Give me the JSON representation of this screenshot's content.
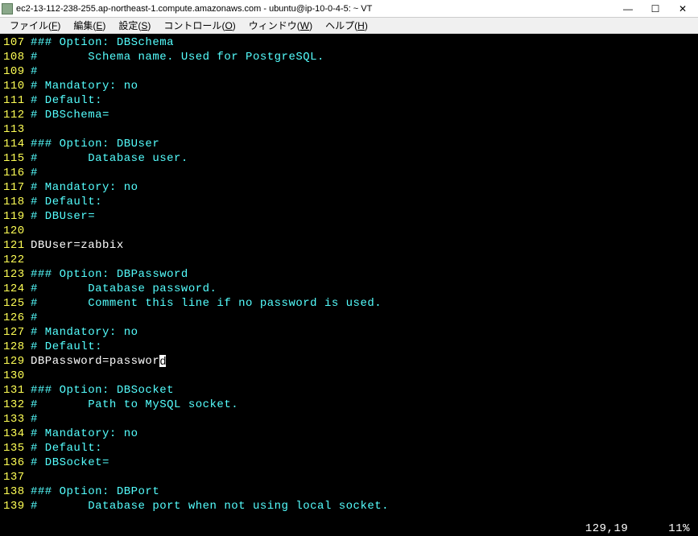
{
  "window": {
    "title": "ec2-13-112-238-255.ap-northeast-1.compute.amazonaws.com - ubuntu@ip-10-0-4-5: ~ VT",
    "minimize": "—",
    "maximize": "☐",
    "close": "✕"
  },
  "menu": {
    "file": {
      "label": "ファイル",
      "accel": "F"
    },
    "edit": {
      "label": "編集",
      "accel": "E"
    },
    "setup": {
      "label": "設定",
      "accel": "S"
    },
    "control": {
      "label": "コントロール",
      "accel": "O"
    },
    "window": {
      "label": "ウィンドウ",
      "accel": "W"
    },
    "help": {
      "label": "ヘルプ",
      "accel": "H"
    }
  },
  "lines": [
    {
      "n": "107",
      "segs": [
        {
          "c": "cyan",
          "t": "### Option: DBSchema"
        }
      ]
    },
    {
      "n": "108",
      "segs": [
        {
          "c": "cyan",
          "t": "#       Schema name. Used for PostgreSQL."
        }
      ]
    },
    {
      "n": "109",
      "segs": [
        {
          "c": "cyan",
          "t": "#"
        }
      ]
    },
    {
      "n": "110",
      "segs": [
        {
          "c": "cyan",
          "t": "# Mandatory: no"
        }
      ]
    },
    {
      "n": "111",
      "segs": [
        {
          "c": "cyan",
          "t": "# Default:"
        }
      ]
    },
    {
      "n": "112",
      "segs": [
        {
          "c": "cyan",
          "t": "# DBSchema="
        }
      ]
    },
    {
      "n": "113",
      "segs": []
    },
    {
      "n": "114",
      "segs": [
        {
          "c": "cyan",
          "t": "### Option: DBUser"
        }
      ]
    },
    {
      "n": "115",
      "segs": [
        {
          "c": "cyan",
          "t": "#       Database user."
        }
      ]
    },
    {
      "n": "116",
      "segs": [
        {
          "c": "cyan",
          "t": "#"
        }
      ]
    },
    {
      "n": "117",
      "segs": [
        {
          "c": "cyan",
          "t": "# Mandatory: no"
        }
      ]
    },
    {
      "n": "118",
      "segs": [
        {
          "c": "cyan",
          "t": "# Default:"
        }
      ]
    },
    {
      "n": "119",
      "segs": [
        {
          "c": "cyan",
          "t": "# DBUser="
        }
      ]
    },
    {
      "n": "120",
      "segs": []
    },
    {
      "n": "121",
      "segs": [
        {
          "c": "white",
          "t": "DBUser=zabbix"
        }
      ]
    },
    {
      "n": "122",
      "segs": []
    },
    {
      "n": "123",
      "segs": [
        {
          "c": "cyan",
          "t": "### Option: DBPassword"
        }
      ]
    },
    {
      "n": "124",
      "segs": [
        {
          "c": "cyan",
          "t": "#       Database password."
        }
      ]
    },
    {
      "n": "125",
      "segs": [
        {
          "c": "cyan",
          "t": "#       Comment this line if no password is used."
        }
      ]
    },
    {
      "n": "126",
      "segs": [
        {
          "c": "cyan",
          "t": "#"
        }
      ]
    },
    {
      "n": "127",
      "segs": [
        {
          "c": "cyan",
          "t": "# Mandatory: no"
        }
      ]
    },
    {
      "n": "128",
      "segs": [
        {
          "c": "cyan",
          "t": "# Default:"
        }
      ]
    },
    {
      "n": "129",
      "segs": [
        {
          "c": "white",
          "t": "DBPassword=passwor"
        },
        {
          "cursor": true,
          "t": "d"
        }
      ]
    },
    {
      "n": "130",
      "segs": []
    },
    {
      "n": "131",
      "segs": [
        {
          "c": "cyan",
          "t": "### Option: DBSocket"
        }
      ]
    },
    {
      "n": "132",
      "segs": [
        {
          "c": "cyan",
          "t": "#       Path to MySQL socket."
        }
      ]
    },
    {
      "n": "133",
      "segs": [
        {
          "c": "cyan",
          "t": "#"
        }
      ]
    },
    {
      "n": "134",
      "segs": [
        {
          "c": "cyan",
          "t": "# Mandatory: no"
        }
      ]
    },
    {
      "n": "135",
      "segs": [
        {
          "c": "cyan",
          "t": "# Default:"
        }
      ]
    },
    {
      "n": "136",
      "segs": [
        {
          "c": "cyan",
          "t": "# DBSocket="
        }
      ]
    },
    {
      "n": "137",
      "segs": []
    },
    {
      "n": "138",
      "segs": [
        {
          "c": "cyan",
          "t": "### Option: DBPort"
        }
      ]
    },
    {
      "n": "139",
      "segs": [
        {
          "c": "cyan",
          "t": "#       Database port when not using local socket."
        }
      ]
    }
  ],
  "status": {
    "position": "129,19",
    "percent": "11%"
  }
}
